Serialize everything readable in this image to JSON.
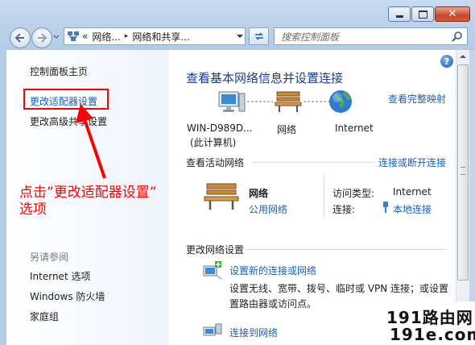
{
  "window": {
    "caption_buttons": [
      "minimize",
      "maximize",
      "close"
    ]
  },
  "nav": {
    "back": "back-icon",
    "forward": "forward-icon"
  },
  "address": {
    "prefix": "«",
    "crumb1": "网络...",
    "crumb2": "网络和共享...",
    "separator": "▸"
  },
  "search": {
    "placeholder": "搜索控制面板"
  },
  "left_pane": {
    "home": "控制面板主页",
    "change_adapter": "更改适配器设置",
    "change_advanced": "更改高级共享设置",
    "see_also_header": "另请参阅",
    "see_also": [
      "Internet 选项",
      "Windows 防火墙",
      "家庭组"
    ]
  },
  "main": {
    "title": "查看基本网络信息并设置连接",
    "full_map": "查看完整映射",
    "map": {
      "computer_name": "WIN-D989D...",
      "computer_sub": "(此计算机)",
      "network": "网络",
      "internet": "Internet"
    },
    "active_header": "查看活动网络",
    "connect_disconnect": "连接或断开连接",
    "active_network": {
      "name": "网络",
      "type": "公用网络",
      "access_label": "访问类型:",
      "access_value": "Internet",
      "conn_label": "连接:",
      "conn_value": "本地连接"
    },
    "change_header": "更改网络设置",
    "tasks": [
      {
        "title": "设置新的连接或网络",
        "desc1": "设置无线、宽带、拨号、临时或 VPN 连接；或设置",
        "desc2": "置路由器或访问点。"
      },
      {
        "title": "连接到网络"
      }
    ]
  },
  "annotation": {
    "line1": "点击”更改适配器设置”",
    "line2": "选项",
    "color": "#ff0000"
  },
  "watermark": {
    "line1": "191路由网",
    "line2": "191e.com"
  }
}
